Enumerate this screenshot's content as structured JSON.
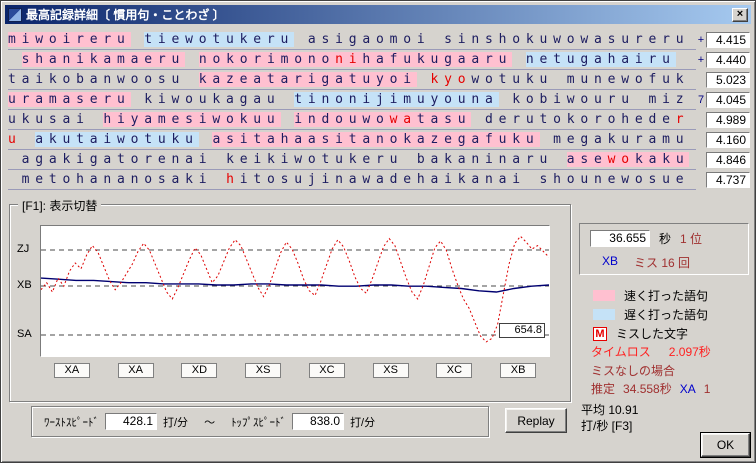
{
  "window": {
    "title": "最高記録詳細〔 慣用句・ことわざ 〕",
    "close_label": "×"
  },
  "colors": {
    "fast_bg": "#ffc0d0",
    "slow_bg": "#c5e2f7",
    "miss": "#e60000",
    "row_text": "#1c1c60",
    "maroon": "#a03030",
    "red": "#ff2020",
    "blue": "#0000cc",
    "titlebar_left": "#0a246a",
    "titlebar_right": "#a6caf0"
  },
  "rows": [
    {
      "mark": "+",
      "value": "4.415",
      "tokens": [
        {
          "t": "miwoireru",
          "bg": "fast"
        },
        {
          "t": " "
        },
        {
          "t": "tiewotukeru",
          "bg": "slow"
        },
        {
          "t": " "
        },
        {
          "t": "asigaomoi"
        },
        {
          "t": " "
        },
        {
          "t": "sinshokuwowasureru"
        }
      ]
    },
    {
      "mark": "+",
      "value": "4.440",
      "tokens": [
        {
          "t": " "
        },
        {
          "t": "shanikamaeru",
          "bg": "fast"
        },
        {
          "t": " "
        },
        {
          "t": "nokorimono",
          "bg": "fast"
        },
        {
          "t": "ni",
          "bg": "fast",
          "miss": true
        },
        {
          "t": "hafukugaaru",
          "bg": "fast"
        },
        {
          "t": " "
        },
        {
          "t": "netugahairu",
          "bg": "slow"
        }
      ]
    },
    {
      "mark": "",
      "value": "5.023",
      "tokens": [
        {
          "t": "taikobanwoosu"
        },
        {
          "t": " "
        },
        {
          "t": "kazeatarigatuyoi",
          "bg": "fast"
        },
        {
          "t": " "
        },
        {
          "t": "kyo",
          "miss": true
        },
        {
          "t": "wotuku"
        },
        {
          "t": " "
        },
        {
          "t": "munewofuk"
        }
      ]
    },
    {
      "mark": "7",
      "value": "4.045",
      "tokens": [
        {
          "t": "uramaseru",
          "bg": "fast"
        },
        {
          "t": " "
        },
        {
          "t": "kiwoukagau"
        },
        {
          "t": " "
        },
        {
          "t": "tinonijimuyouna",
          "bg": "slow"
        },
        {
          "t": " "
        },
        {
          "t": "kobiwouru"
        },
        {
          "t": " "
        },
        {
          "t": "miz"
        }
      ]
    },
    {
      "mark": "",
      "value": "4.989",
      "tokens": [
        {
          "t": "ukusai"
        },
        {
          "t": " "
        },
        {
          "t": "hiyamesiwokuu",
          "bg": "fast"
        },
        {
          "t": " "
        },
        {
          "t": "indouwo",
          "bg": "fast"
        },
        {
          "t": "wa",
          "bg": "fast",
          "miss": true
        },
        {
          "t": "tasu",
          "bg": "fast"
        },
        {
          "t": " "
        },
        {
          "t": "derutokorohede"
        },
        {
          "t": "r",
          "miss": true
        }
      ]
    },
    {
      "mark": "",
      "value": "4.160",
      "tokens": [
        {
          "t": "u",
          "miss": true
        },
        {
          "t": " "
        },
        {
          "t": "akutaiwotuku",
          "bg": "slow"
        },
        {
          "t": " "
        },
        {
          "t": "asitahaasitanokazegafuku",
          "bg": "fast"
        },
        {
          "t": " "
        },
        {
          "t": "megakuramu"
        }
      ]
    },
    {
      "mark": "",
      "value": "4.846",
      "tokens": [
        {
          "t": " "
        },
        {
          "t": "agakigatorenai"
        },
        {
          "t": " "
        },
        {
          "t": "keikiwotukeru"
        },
        {
          "t": " "
        },
        {
          "t": "bakaninaru"
        },
        {
          "t": " "
        },
        {
          "t": "ase",
          "bg": "fast"
        },
        {
          "t": "wo",
          "bg": "fast",
          "miss": true
        },
        {
          "t": "kaku",
          "bg": "fast"
        }
      ]
    },
    {
      "mark": "",
      "value": "4.737",
      "tokens": [
        {
          "t": " "
        },
        {
          "t": "metohananosaki"
        },
        {
          "t": " "
        },
        {
          "t": "h",
          "miss": true
        },
        {
          "t": "itosujinawadehaikanai"
        },
        {
          "t": " "
        },
        {
          "t": "shounewosue"
        }
      ]
    }
  ],
  "chart_panel": {
    "group_label": "[F1]: 表示切替",
    "y_labels": [
      "ZJ",
      "XB",
      "SA"
    ],
    "current_value": "654.8",
    "lap_labels": [
      "XA",
      "XA",
      "XD",
      "XS",
      "XC",
      "XS",
      "XC",
      "XB"
    ]
  },
  "chart_data": {
    "type": "line",
    "y_axis_ticks": [
      "ZJ",
      "XB",
      "SA"
    ],
    "end_value_label": "654.8",
    "section_grades": [
      "XA",
      "XA",
      "XD",
      "XS",
      "XC",
      "XS",
      "XC",
      "XB"
    ],
    "series": [
      {
        "name": "instant-speed",
        "color": "#dd0000",
        "style": "dotted",
        "values": [
          52,
          58,
          50,
          62,
          55,
          68,
          75,
          70,
          82,
          90,
          84,
          72,
          60,
          52,
          58,
          66,
          74,
          85,
          92,
          86,
          74,
          62,
          50,
          44,
          54,
          66,
          78,
          88,
          82,
          70,
          58,
          64,
          76,
          88,
          95,
          90,
          78,
          66,
          54,
          46,
          56,
          70,
          84,
          93,
          87,
          75,
          61,
          51,
          47,
          59,
          73,
          87,
          95,
          89,
          77,
          63,
          53,
          49,
          61,
          75,
          89,
          96,
          90,
          76,
          62,
          50,
          44,
          56,
          72,
          88,
          94,
          86,
          70,
          56,
          44,
          36,
          24,
          12,
          7,
          10,
          22,
          48,
          74,
          92,
          98,
          93,
          87,
          90,
          85,
          80
        ]
      },
      {
        "name": "average-speed",
        "color": "#000070",
        "style": "solid",
        "values": [
          62,
          61,
          60,
          60,
          59,
          58,
          58,
          57,
          57,
          57,
          56,
          56,
          57,
          57,
          56,
          56,
          56,
          55,
          55,
          56,
          56,
          55,
          55,
          54,
          53,
          51,
          50,
          53,
          55,
          56
        ]
      }
    ]
  },
  "speed_bar": {
    "worst_label": "ﾜｰｽﾄｽﾋﾟｰﾄﾞ",
    "worst_value": "428.1",
    "unit1": "打/分",
    "tilde": "～",
    "top_label": "ﾄｯﾌﾟｽﾋﾟｰﾄﾞ",
    "top_value": "838.0",
    "unit2": "打/分",
    "replay_label": "Replay"
  },
  "result_panel": {
    "time_value": "36.655",
    "time_unit": "秒",
    "rank": "1 位",
    "grade": "XB",
    "miss_label": "ミス 16 回",
    "legend": [
      {
        "swatch": "fast",
        "label": "速く打った語句"
      },
      {
        "swatch": "slow",
        "label": "遅く打った語句"
      },
      {
        "swatch": "miss",
        "glyph": "M",
        "label": "ミスした文字"
      }
    ],
    "time_loss_label": "タイムロス",
    "time_loss_value": "2.097秒",
    "no_miss_label": "ミスなしの場合",
    "estimate_label": "推定",
    "estimate_value": "34.558秒",
    "estimate_grade": "XA",
    "estimate_rank": "1",
    "average_line1": "平均 10.91",
    "average_line2": "打/秒 [F3]",
    "ok_label": "OK"
  }
}
